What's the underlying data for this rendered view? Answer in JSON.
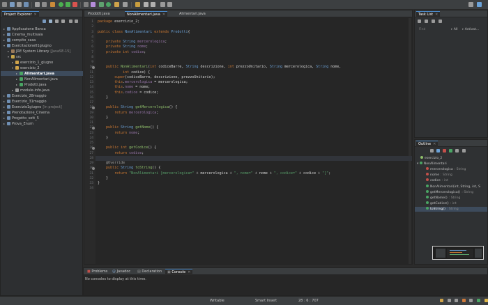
{
  "package_explorer": {
    "title": "Project Explorer",
    "items": [
      {
        "label": "Applicazione Banca",
        "sub": "",
        "arrow": "▸"
      },
      {
        "label": "Cinema_multisala",
        "sub": "",
        "arrow": "▸"
      },
      {
        "label": "compito_casa",
        "sub": "",
        "arrow": "▸"
      },
      {
        "label": "Esercitazione01giugno",
        "sub": "",
        "arrow": "▾"
      },
      {
        "label": "JRE System Library",
        "sub": "[JavaSE-15]",
        "arrow": "▸"
      },
      {
        "label": "src",
        "sub": "",
        "arrow": "▾"
      },
      {
        "label": "esercizio_1_giugno",
        "sub": "",
        "arrow": "▸"
      },
      {
        "label": "esercizio_2",
        "sub": "",
        "arrow": "▾"
      },
      {
        "label": "Alimentari.java",
        "sub": "",
        "arrow": "▸"
      },
      {
        "label": "NonAlimentari.java",
        "sub": "",
        "arrow": "▸"
      },
      {
        "label": "Prodotti.java",
        "sub": "",
        "arrow": "▸"
      },
      {
        "label": "module-info.java",
        "sub": "",
        "arrow": "▸"
      },
      {
        "label": "Esercizio_28maggio",
        "sub": "",
        "arrow": "▸"
      },
      {
        "label": "Esercizio_31maggio",
        "sub": "",
        "arrow": "▸"
      },
      {
        "label": "Esercizio1giugno",
        "sub": "[in project]",
        "arrow": "▸"
      },
      {
        "label": "Prenotazione_Cinema",
        "sub": "",
        "arrow": "▸"
      },
      {
        "label": "Progetto_sett_5",
        "sub": "",
        "arrow": "▸"
      },
      {
        "label": "Prova_Enum",
        "sub": "",
        "arrow": "▸"
      }
    ]
  },
  "editor": {
    "tabs": [
      {
        "label": "Prodotti.java"
      },
      {
        "label": "NonAlimentari.java"
      },
      {
        "label": "Alimentari.java"
      }
    ],
    "lines": [
      {
        "n": "1",
        "html": "<span class='kw'>package</span> esercizio_2;"
      },
      {
        "n": "2",
        "html": ""
      },
      {
        "n": "3",
        "html": "<span class='kw'>public class</span> <span class='ty'>NonAlimentari</span> <span class='kw'>extends</span> <span class='ty'>Prodotti</span>{"
      },
      {
        "n": "4",
        "html": ""
      },
      {
        "n": "5",
        "html": "    <span class='kw'>private</span> <span class='ty'>String</span> <span class='fd'>mercerologica</span>;"
      },
      {
        "n": "6",
        "html": "    <span class='kw'>private</span> <span class='ty'>String</span> <span class='fd'>nome</span>;"
      },
      {
        "n": "7",
        "html": "    <span class='kw'>private int</span> <span class='fd'>codice</span>;"
      },
      {
        "n": "8",
        "html": ""
      },
      {
        "n": "9",
        "html": ""
      },
      {
        "n": "10",
        "html": "    <span class='kw'>public</span> <span class='fn'>NonAlimentari</span>(<span class='kw'>int</span> codiceBarre, <span class='ty'>String</span> descrizione, <span class='kw'>int</span> prezzoUnitario, <span class='ty'>String</span> mercerologica, <span class='ty'>String</span> nome,"
      },
      {
        "n": "11",
        "html": "            <span class='kw'>int</span> codice) {"
      },
      {
        "n": "12",
        "html": "        <span class='kw'>super</span>(codiceBarre, descrizione, prezzoUnitario);"
      },
      {
        "n": "13",
        "html": "        <span class='kw'>this</span>.<span class='fd'>mercerologica</span> = mercerologica;"
      },
      {
        "n": "14",
        "html": "        <span class='kw'>this</span>.<span class='fd'>nome</span> = nome;"
      },
      {
        "n": "15",
        "html": "        <span class='kw'>this</span>.<span class='fd'>codice</span> = codice;"
      },
      {
        "n": "16",
        "html": "    }"
      },
      {
        "n": "17",
        "html": ""
      },
      {
        "n": "18",
        "html": "    <span class='kw'>public</span> <span class='ty'>String</span> <span class='fn'>getMercerologica</span>() {"
      },
      {
        "n": "19",
        "html": "        <span class='kw'>return</span> <span class='fd'>mercerologica</span>;"
      },
      {
        "n": "20",
        "html": "    }"
      },
      {
        "n": "21",
        "html": ""
      },
      {
        "n": "22",
        "html": "    <span class='kw'>public</span> <span class='ty'>String</span> <span class='fn'>getNome</span>() {"
      },
      {
        "n": "23",
        "html": "        <span class='kw'>return</span> <span class='fd'>nome</span>;"
      },
      {
        "n": "24",
        "html": "    }"
      },
      {
        "n": "25",
        "html": ""
      },
      {
        "n": "26",
        "html": "    <span class='kw'>public int</span> <span class='fn'>getCodice</span>() {"
      },
      {
        "n": "27",
        "html": "        <span class='kw'>return</span> <span class='fd'>codice</span>;"
      },
      {
        "n": "28",
        "html": "    }"
      },
      {
        "n": "29",
        "html": "    <span class='an'>@Override</span>"
      },
      {
        "n": "30",
        "html": "    <span class='kw'>public</span> <span class='ty'>String</span> <span class='fn'>toString</span>() {"
      },
      {
        "n": "31",
        "html": "        <span class='kw'>return</span> <span class='st'>\"NonAlimentari [mercerologica=\"</span> + mercerologica + <span class='st'>\", nome=\"</span> + nome + <span class='st'>\", codice=\"</span> + codice + <span class='st'>\"]\"</span>;"
      },
      {
        "n": "32",
        "html": "    }"
      },
      {
        "n": "33",
        "html": "}"
      },
      {
        "n": "34",
        "html": ""
      }
    ]
  },
  "task_list": {
    "title": "Task List",
    "find_placeholder": "Find",
    "all_label": "All",
    "activate_label": "Activat..."
  },
  "outline": {
    "title": "Outline",
    "items": [
      {
        "label": "esercizio_2",
        "type": "",
        "color": "#8fbf6b"
      },
      {
        "label": "NonAlimentari",
        "type": "",
        "color": "#4aa564"
      },
      {
        "label": "mercerologica",
        "type": ": String",
        "color": "#c2504a"
      },
      {
        "label": "nome",
        "type": ": String",
        "color": "#c2504a"
      },
      {
        "label": "codice",
        "type": ": int",
        "color": "#c2504a"
      },
      {
        "label": "NonAlimentari(int, String, int, S",
        "type": "",
        "color": "#4aa564"
      },
      {
        "label": "getMercerologica()",
        "type": ": String",
        "color": "#4aa564"
      },
      {
        "label": "getNome()",
        "type": ": String",
        "color": "#4aa564"
      },
      {
        "label": "getCodice()",
        "type": ": int",
        "color": "#4aa564"
      },
      {
        "label": "toString()",
        "type": ": String",
        "color": "#4aa564"
      }
    ]
  },
  "console": {
    "tabs": [
      {
        "label": "Problems"
      },
      {
        "label": "Javadoc"
      },
      {
        "label": "Declaration"
      },
      {
        "label": "Console"
      }
    ],
    "message": "No consoles to display at this time."
  },
  "status": {
    "writable": "Writable",
    "insert_mode": "Smart Insert",
    "position": "28 : 6 : 707"
  },
  "colors": {
    "accent": "#4a88c7",
    "background": "#2b2b2b"
  }
}
